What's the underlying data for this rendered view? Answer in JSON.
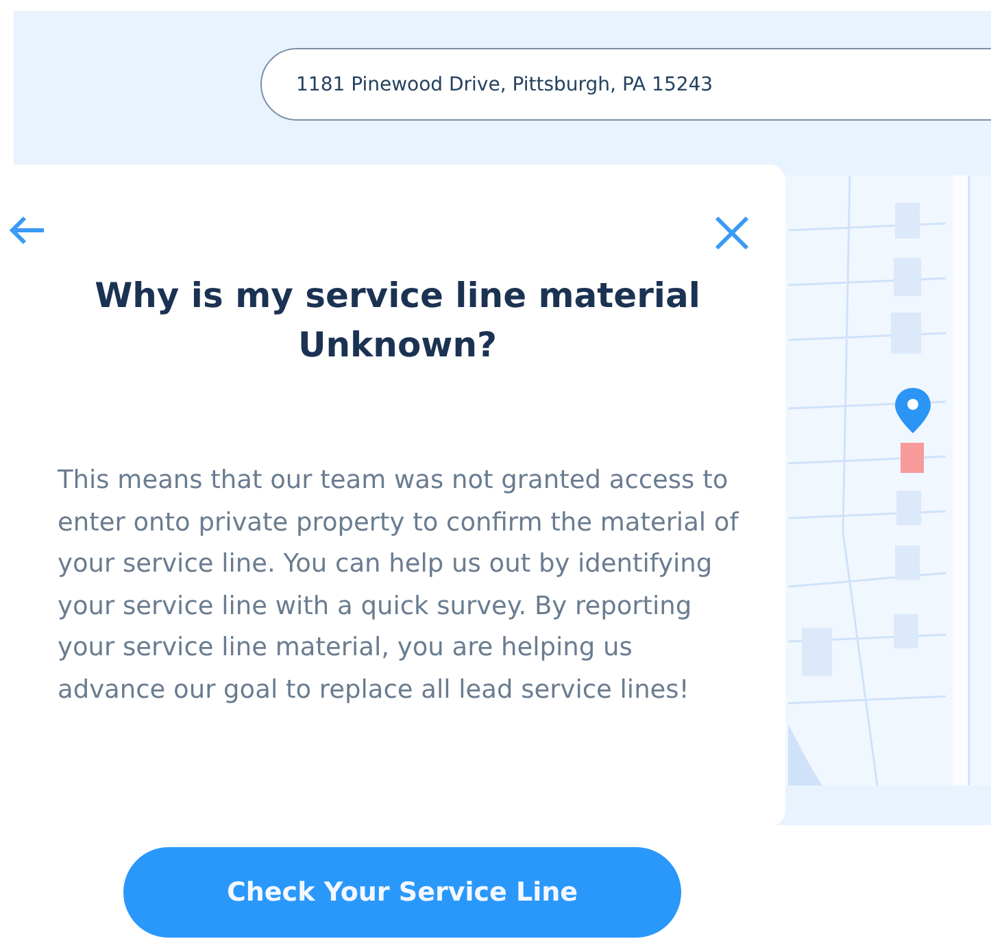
{
  "search": {
    "value": "1181 Pinewood Drive, Pittsburgh, PA 15243"
  },
  "dialog": {
    "title": "Why is my service line material Unknown?",
    "body": "This means that our team was not granted access to enter onto private property to confirm the material of your service line. You can help us out by identifying your service line with a quick survey. By reporting your service line material, you are helping us advance our goal to replace all lead service lines!"
  },
  "button": {
    "label": "Check Your Service Line"
  }
}
